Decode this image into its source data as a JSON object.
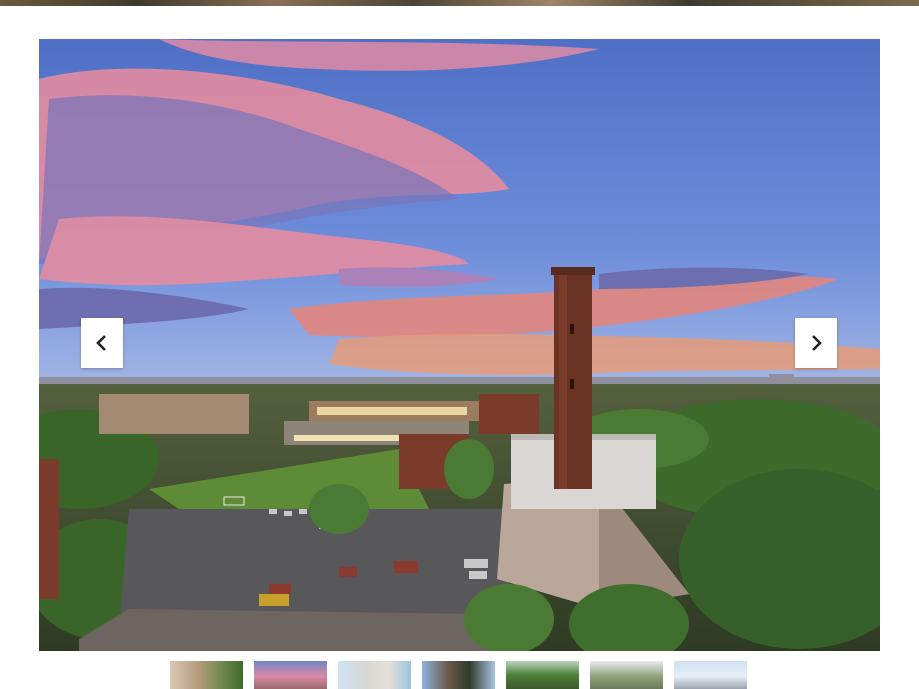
{
  "top_strip": {
    "label": ""
  },
  "gallery": {
    "main_image": {
      "subject": "aerial-campus-sunset-tower"
    },
    "prev_button": {
      "icon": "chevron-left-icon"
    },
    "next_button": {
      "icon": "chevron-right-icon"
    },
    "active_thumbnail": 2,
    "thumbnail_count": 7
  },
  "colors": {
    "sky_top": "#5f7fd0",
    "sky_horizon": "#c9a7c2",
    "cloud_pink": "#e98aa0",
    "tower_brick": "#6b3324",
    "trees": "#3f6b2a",
    "field": "#5e8b35"
  }
}
